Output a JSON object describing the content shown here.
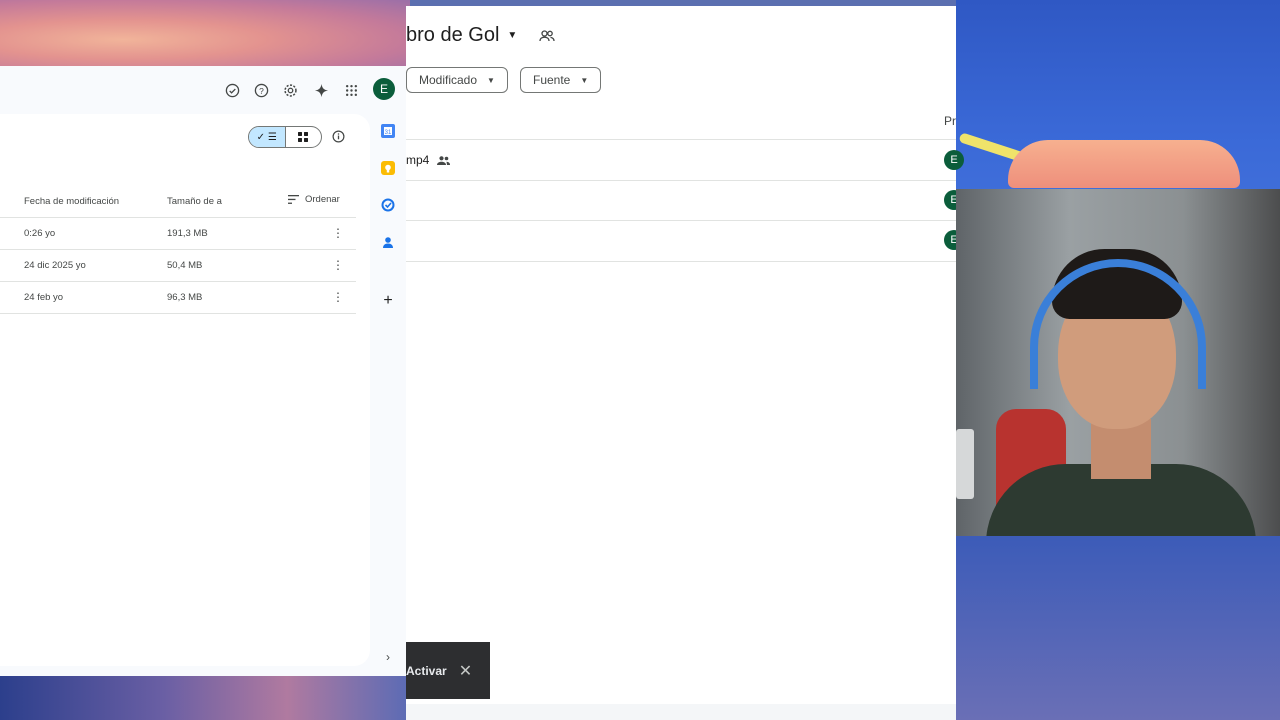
{
  "left_window": {
    "topbar_icons": [
      "offline-check-icon",
      "help-icon",
      "settings-icon",
      "gemini-sparkle-icon",
      "apps-grid-icon"
    ],
    "avatar_letter": "E",
    "columns": {
      "modified": "Fecha de modificación",
      "size": "Tamaño de a",
      "sort": "Ordenar"
    },
    "rows": [
      {
        "modified": "0:26 yo",
        "size": "191,3 MB"
      },
      {
        "modified": "24 dic 2025 yo",
        "size": "50,4 MB"
      },
      {
        "modified": "24 feb yo",
        "size": "96,3 MB"
      }
    ],
    "side_rail": [
      "calendar-icon",
      "keep-icon",
      "tasks-icon",
      "contacts-icon",
      "add-icon"
    ]
  },
  "mid_window": {
    "title": "bro de Gol",
    "filters": {
      "modified": "Modificado",
      "source": "Fuente"
    },
    "column_header_partial": "Pr",
    "file_name_partial": "mp4",
    "owner_avatar": "E",
    "snackbar_action": "Activar"
  },
  "colors": {
    "accent_toggle": "#c2e7ff",
    "avatar_bg": "#0b5d3b",
    "snackbar_bg": "#2d2e30"
  }
}
